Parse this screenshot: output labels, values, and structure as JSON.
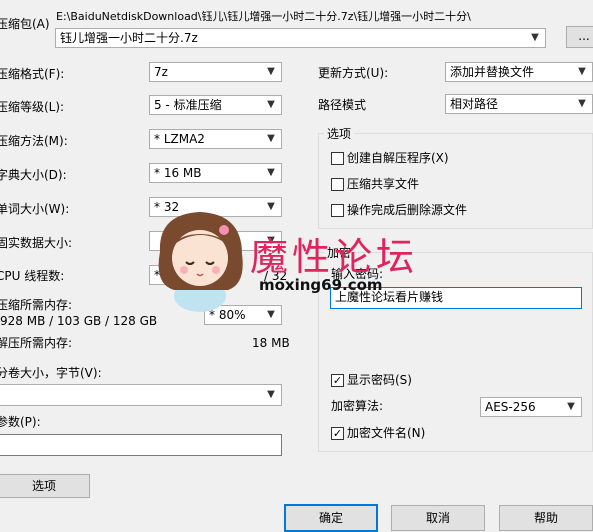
{
  "archive": {
    "label": "压缩包(A)",
    "path": "E:\\BaiduNetdiskDownload\\钰儿\\钰儿增强一小时二十分.7z\\钰儿增强一小时二十分\\",
    "name": "钰儿增强一小时二十分.7z",
    "browse_label": "..."
  },
  "left": {
    "format_label": "压缩格式(F):",
    "format_value": "7z",
    "level_label": "压缩等级(L):",
    "level_value": "5 - 标准压缩",
    "method_label": "压缩方法(M):",
    "method_value": "* LZMA2",
    "dict_label": "字典大小(D):",
    "dict_value": "* 16 MB",
    "word_label": "单词大小(W):",
    "word_value": "* 32",
    "solid_label": "固实数据大小:",
    "threads_label": "CPU 线程数:",
    "threads_value": "* 32",
    "threads_total": "/ 32",
    "mem_compress_label": "压缩所需内存:",
    "mem_compress_value": "928 MB / 103 GB / 128 GB",
    "mem_percent": "* 80%",
    "mem_decompress_label": "解压所需内存:",
    "mem_decompress_value": "18 MB",
    "volume_label": "分卷大小，字节(V):",
    "params_label": "参数(P):",
    "options_button": "选项"
  },
  "right": {
    "update_label": "更新方式(U):",
    "update_value": "添加并替换文件",
    "path_label": "路径模式",
    "path_value": "相对路径",
    "options_group": "选项",
    "opt_sfx": "创建自解压程序(X)",
    "opt_shared": "压缩共享文件",
    "opt_delete": "操作完成后删除源文件",
    "encrypt_group": "加密",
    "password_label": "输入密码:",
    "password_value": "上魔性论坛看片赚钱",
    "show_password": "显示密码(S)",
    "algo_label": "加密算法:",
    "algo_value": "AES-256",
    "encrypt_names": "加密文件名(N)"
  },
  "buttons": {
    "ok": "确定",
    "cancel": "取消",
    "help": "帮助"
  },
  "watermark": {
    "brand": "魔性论坛",
    "site": "moxing69.com"
  },
  "icons": {
    "dropdown": "chevron-down-icon",
    "check": "checkmark-icon"
  },
  "colors": {
    "accent": "#0078d7",
    "watermark": "#e0245e"
  }
}
